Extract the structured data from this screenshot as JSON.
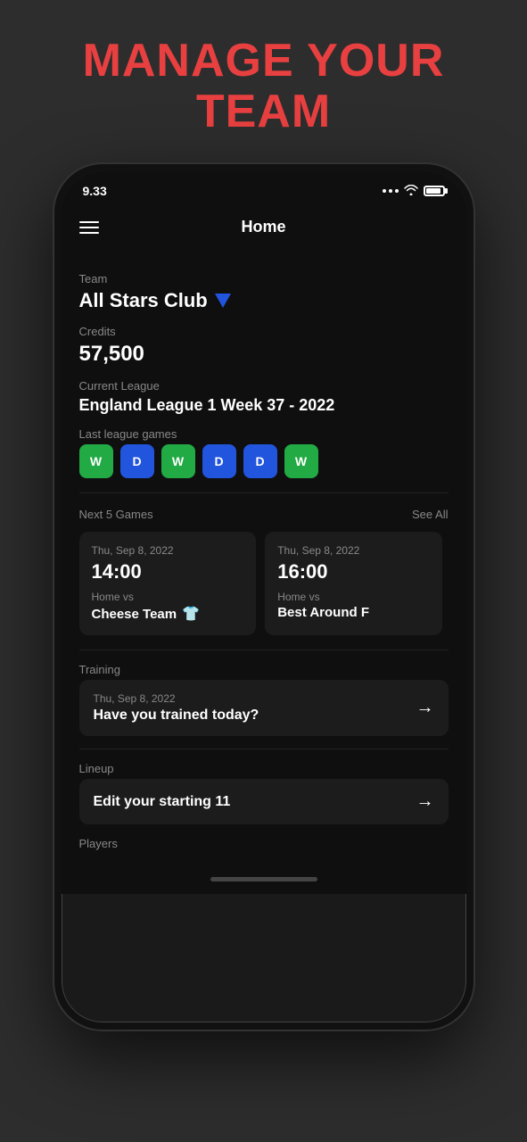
{
  "page": {
    "headline_line1": "MANAGE YOUR",
    "headline_line2": "TEAM"
  },
  "status_bar": {
    "time": "9.33",
    "battery_label": "battery"
  },
  "nav": {
    "title": "Home"
  },
  "team": {
    "label": "Team",
    "name": "All Stars Club"
  },
  "credits": {
    "label": "Credits",
    "value": "57,500"
  },
  "league": {
    "label": "Current League",
    "name": "England League 1 Week 37 - 2022"
  },
  "last_games": {
    "label": "Last league games",
    "results": [
      {
        "type": "W",
        "css": "result-w"
      },
      {
        "type": "D",
        "css": "result-d"
      },
      {
        "type": "W",
        "css": "result-w"
      },
      {
        "type": "D",
        "css": "result-d"
      },
      {
        "type": "D",
        "css": "result-d"
      },
      {
        "type": "W",
        "css": "result-w"
      }
    ]
  },
  "next_games": {
    "section_label": "Next 5 Games",
    "see_all_label": "See All",
    "games": [
      {
        "date": "Thu, Sep 8, 2022",
        "time": "14:00",
        "vs_label": "Home vs",
        "opponent": "Cheese Team",
        "has_shirt": true
      },
      {
        "date": "Thu, Sep 8, 2022",
        "time": "16:00",
        "vs_label": "Home vs",
        "opponent": "Best Around F",
        "has_shirt": false
      }
    ]
  },
  "training": {
    "section_label": "Training",
    "card_date": "Thu, Sep 8, 2022",
    "card_title": "Have you trained today?",
    "arrow": "→"
  },
  "lineup": {
    "section_label": "Lineup",
    "card_title": "Edit your starting 11",
    "arrow": "→"
  },
  "players": {
    "section_label": "Players"
  },
  "icons": {
    "hamburger": "menu",
    "shield": "shield",
    "shirt": "👕",
    "arrow_right": "→"
  }
}
